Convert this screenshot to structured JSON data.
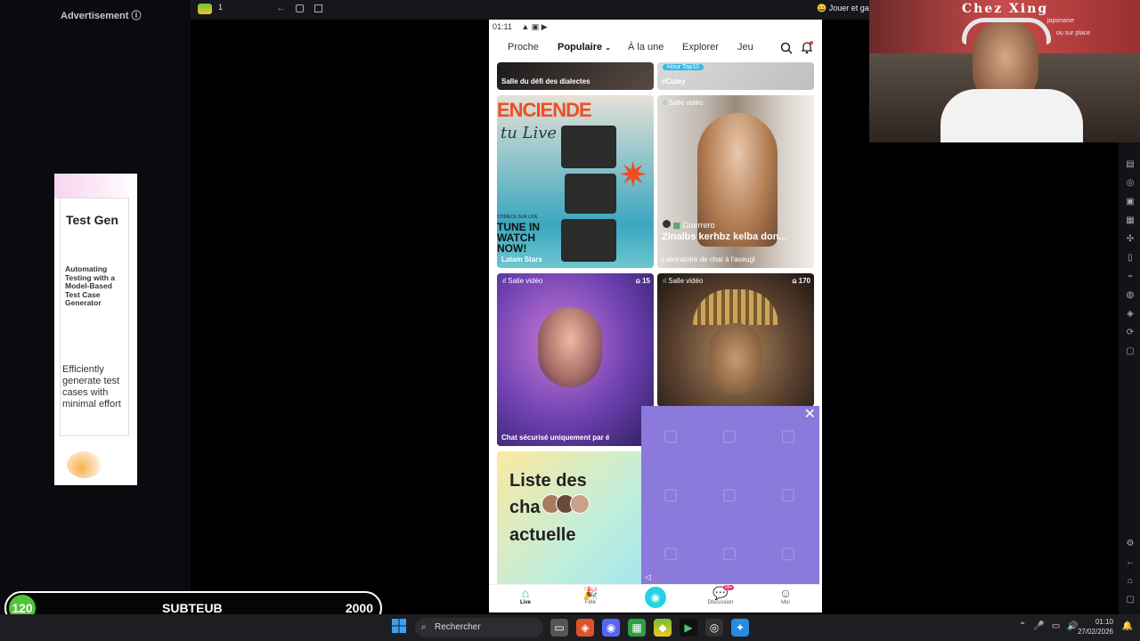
{
  "ad": {
    "label": "Advertisement",
    "info_icon": "info-circle-icon",
    "title": "Test Gen",
    "description": "Automating Testing with a Model-Based Test Case Generator",
    "body": "Efficiently generate test cases with minimal effort",
    "adchoices_icon": "adchoices-icon"
  },
  "browser_bar": {
    "tab_label": "1",
    "right_text": "Jouer et ga"
  },
  "app": {
    "status_time": "01:11",
    "nav": {
      "proche": "Proche",
      "populaire": "Populaire",
      "a_la_une": "À la une",
      "explorer": "Explorer",
      "jeu": "Jeu"
    },
    "tiles": [
      {
        "label": "Salle du défi des dialectes"
      },
      {
        "tag": "Hour Top10",
        "label": "#Cutey"
      },
      {
        "art_title": "ENCIENDE",
        "art_sub": "tu Live",
        "art_cta": "TUNE IN WATCH NOW!",
        "art_small": "COMECE SUA LIVE",
        "label": "Latam Stars"
      },
      {
        "tag": "Salle vidéo",
        "host": "Guerrero",
        "title": "Zinalbs kerhbz kelba don...",
        "label": "Laboratoire de chat à l'aveugl"
      },
      {
        "tag": "Salle vidéo",
        "count": "15",
        "label": "Chat sécurisé uniquement par é"
      },
      {
        "tag": "Salle vidéo",
        "count": "170"
      },
      {
        "title_line1": "Liste des",
        "title_line2": "cha",
        "title_line3": "actuelle"
      }
    ],
    "bottom_nav": {
      "live": "Live",
      "fete": "Fête",
      "discussion": "Discussion",
      "discussion_badge": "99+",
      "moi": "Moi"
    }
  },
  "webcam": {
    "sign_text": "Chez Xing",
    "sign_sub": "japonaise",
    "sign_sub2": "ou sur place"
  },
  "score": {
    "level": "120",
    "name": "SUBTEUB",
    "total": "2000"
  },
  "taskbar": {
    "search_placeholder": "Rechercher",
    "time": "01:10",
    "date": "27/02/2026"
  }
}
